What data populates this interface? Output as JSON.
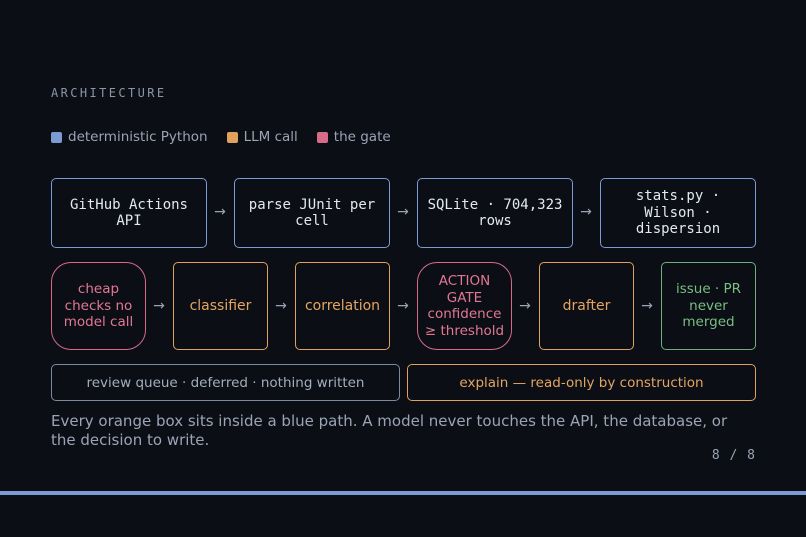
{
  "slide": {
    "eyebrow": "ARCHITECTURE",
    "legend": [
      {
        "label": "deterministic Python",
        "color": "#7c9ad4"
      },
      {
        "label": "LLM call",
        "color": "#e0a15c"
      },
      {
        "label": "the gate",
        "color": "#d86b88"
      }
    ],
    "row1": [
      {
        "label": "GitHub Actions API"
      },
      {
        "label": "parse JUnit per cell"
      },
      {
        "label": "SQLite · 704,323 rows"
      },
      {
        "label": "stats.py · Wilson · dispersion"
      }
    ],
    "row2": [
      {
        "label": "cheap checks no model call"
      },
      {
        "label": "classifier"
      },
      {
        "label": "correlation"
      },
      {
        "label": "ACTION GATE confidence ≥ threshold"
      },
      {
        "label": "drafter"
      },
      {
        "label": "issue · PR never merged"
      }
    ],
    "arrow": "→",
    "row3": [
      {
        "label": "review queue · deferred · nothing written"
      },
      {
        "label": "explain — read-only by construction"
      }
    ],
    "caption": "Every orange box sits inside a blue path. A model never touches the API, the database, or the decision to write.",
    "pager": "8 / 8"
  }
}
